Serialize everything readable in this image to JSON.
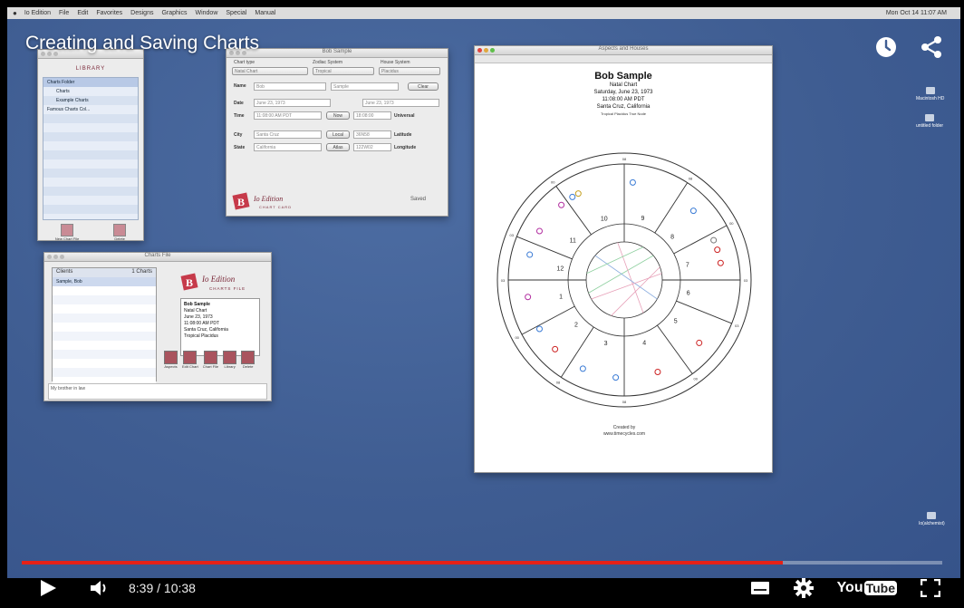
{
  "video": {
    "title": "Creating and Saving Charts",
    "current_time": "8:39",
    "duration": "10:38",
    "time_display": "8:39 / 10:38",
    "progress": 0.827
  },
  "menubar": {
    "items": [
      "Io Edition",
      "File",
      "Edit",
      "Favorites",
      "Designs",
      "Graphics",
      "Window",
      "Special",
      "Manual"
    ],
    "clock": "Mon Oct 14  11:07 AM"
  },
  "library_window": {
    "header": "LIBRARY",
    "tree": [
      "Charts Folder",
      "Charts",
      "Example Charts",
      "Famous Charts Col..."
    ],
    "buttons": [
      "New Chart File",
      "Delete"
    ]
  },
  "chart_file_window": {
    "title": "Charts File",
    "list_header": "Clients",
    "list_count": "1 Charts",
    "rows": [
      "Sample, Bob"
    ],
    "logo_text": "Io Edition",
    "logo_sub": "CHARTS FILE",
    "info": [
      "Bob Sample",
      "Natal Chart",
      "June 23, 1973",
      "11:08:00 AM PDT",
      "Santa Cruz, California",
      "Tropical    Placidus"
    ],
    "comment": "My brother in law",
    "buttons": [
      "Aspects",
      "Edit Chart",
      "Chart File",
      "Library",
      "Delete"
    ]
  },
  "edit_window": {
    "title": "Bob Sample",
    "chart_type_label": "Chart type",
    "chart_type": "Natal Chart",
    "zodiac_label": "Zodiac System",
    "zodiac": "Tropical",
    "house_label": "House System",
    "house": "Placidus",
    "name_label": "Name",
    "first_name": "Bob",
    "last_name": "Sample",
    "clear_btn": "Clear",
    "date_label": "Date",
    "date": "June 23, 1973",
    "date_univ": "June 23, 1973",
    "time_label": "Time",
    "time": "11:08:00 AM PDT",
    "now_btn": "Now",
    "time_univ": "18:08:00",
    "universal_label": "Universal",
    "city_label": "City",
    "city": "Santa Cruz",
    "local_btn": "Local",
    "latitude": "36N58",
    "latitude_label": "Latitude",
    "state_label": "State",
    "state": "California",
    "atlas_btn": "Atlas",
    "longitude": "122W02",
    "longitude_label": "Longitude",
    "logo_text": "Io Edition",
    "logo_sub": "CHART CARD",
    "status": "Saved"
  },
  "aspects_window": {
    "title": "Aspects and Houses",
    "name": "Bob Sample",
    "lines": [
      "Natal Chart",
      "Saturday, June 23, 1973",
      "11:08:00 AM PDT",
      "Santa Cruz, California"
    ],
    "subline": "Tropical  Placidus True Node",
    "houses": [
      "1",
      "2",
      "3",
      "4",
      "5",
      "6",
      "7",
      "8",
      "9",
      "10",
      "11",
      "12"
    ],
    "cusps": [
      "03",
      "00",
      "08",
      "08",
      "00",
      "03",
      "03",
      "00",
      "08",
      "08",
      "00",
      "03"
    ],
    "footer": [
      "Created by",
      "www.timecycles.com"
    ]
  },
  "desktop": {
    "icons": [
      "Macintosh HD",
      "untitled folder",
      "Io(alchemist)"
    ]
  }
}
